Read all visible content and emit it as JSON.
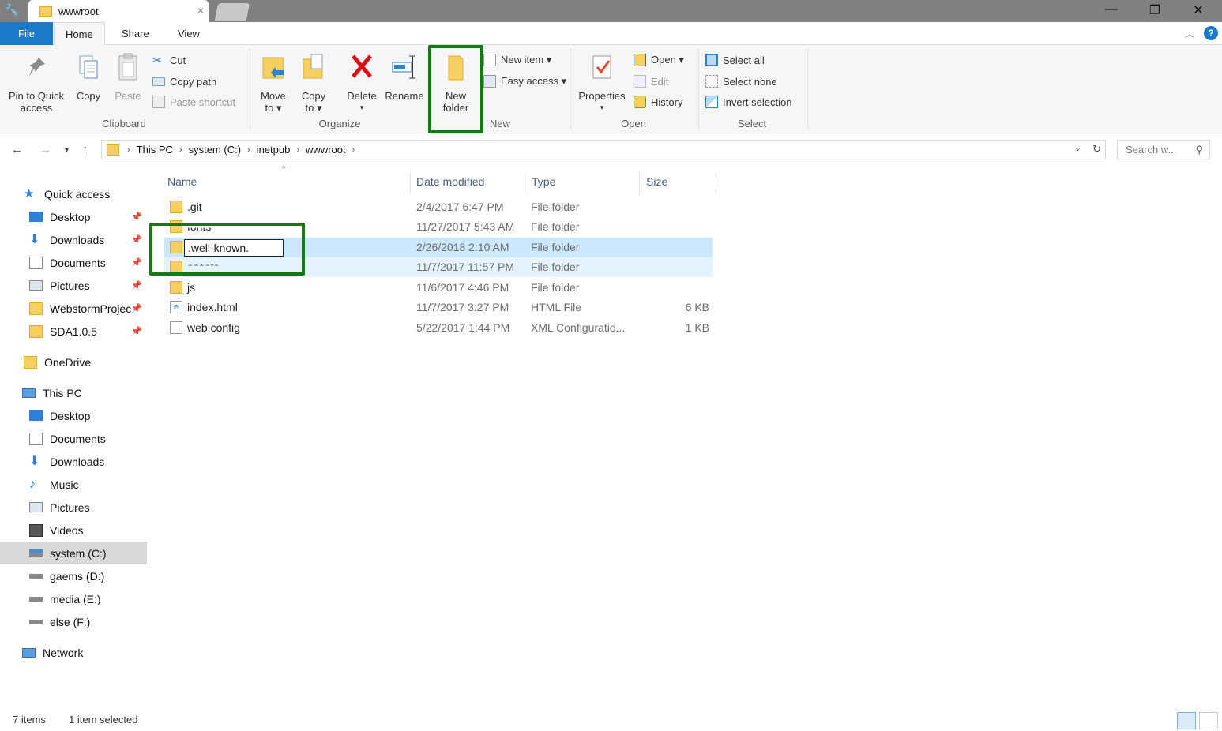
{
  "window": {
    "tab_title": "wwwroot",
    "tab_close": "×",
    "min": "—",
    "max": "❐",
    "close": "✕"
  },
  "ribbon_tabs": {
    "file": "File",
    "home": "Home",
    "share": "Share",
    "view": "View"
  },
  "clipboard": {
    "pin": "Pin to Quick access",
    "pin_l1": "Pin to Quick",
    "pin_l2": "access",
    "copy": "Copy",
    "paste": "Paste",
    "cut": "Cut",
    "copy_path": "Copy path",
    "paste_shortcut": "Paste shortcut",
    "label": "Clipboard"
  },
  "organize": {
    "move_l1": "Move",
    "move_l2": "to ▾",
    "copy_l1": "Copy",
    "copy_l2": "to ▾",
    "delete": "Delete",
    "delete_arrow": "▾",
    "rename": "Rename",
    "label": "Organize"
  },
  "new": {
    "folder_l1": "New",
    "folder_l2": "folder",
    "new_item": "New item ▾",
    "easy_access": "Easy access ▾",
    "label": "New"
  },
  "open": {
    "properties": "Properties",
    "properties_arrow": "▾",
    "open": "Open ▾",
    "edit": "Edit",
    "history": "History",
    "label": "Open"
  },
  "select": {
    "all": "Select all",
    "none": "Select none",
    "invert": "Invert selection",
    "label": "Select"
  },
  "address": {
    "crumbs": [
      "This PC",
      "system (C:)",
      "inetpub",
      "wwwroot"
    ],
    "sep": "›",
    "search_placeholder": "Search w..."
  },
  "sidebar": {
    "quick_access": "Quick access",
    "quick_items": [
      "Desktop",
      "Downloads",
      "Documents",
      "Pictures",
      "WebstormProjec",
      "SDA1.0.5"
    ],
    "onedrive": "OneDrive",
    "this_pc": "This PC",
    "pc_items": [
      "Desktop",
      "Documents",
      "Downloads",
      "Music",
      "Pictures",
      "Videos",
      "system (C:)",
      "gaems (D:)",
      "media (E:)",
      "else (F:)"
    ],
    "network": "Network"
  },
  "columns": {
    "name": "Name",
    "date": "Date modified",
    "type": "Type",
    "size": "Size"
  },
  "files": [
    {
      "name": ".git",
      "date": "2/4/2017 6:47 PM",
      "type": "File folder",
      "size": ""
    },
    {
      "name": "fonts",
      "date": "11/27/2017 5:43 AM",
      "type": "File folder",
      "size": ""
    },
    {
      "name": ".well-known",
      "date": "2/26/2018 2:10 AM",
      "type": "File folder",
      "size": ""
    },
    {
      "name": "assets",
      "date": "11/7/2017 11:57 PM",
      "type": "File folder",
      "size": ""
    },
    {
      "name": "js",
      "date": "11/6/2017 4:46 PM",
      "type": "File folder",
      "size": ""
    },
    {
      "name": "index.html",
      "date": "11/7/2017 3:27 PM",
      "type": "HTML File",
      "size": "6 KB"
    },
    {
      "name": "web.config",
      "date": "5/22/2017 1:44 PM",
      "type": "XML Configuratio...",
      "size": "1 KB"
    }
  ],
  "rename_value": ".well-known.",
  "status": {
    "items": "7 items",
    "selected": "1 item selected"
  },
  "colors": {
    "accent": "#1979ca",
    "highlight": "#117b11",
    "selected_row": "#cce8ff",
    "folder": "#f5cf62"
  }
}
